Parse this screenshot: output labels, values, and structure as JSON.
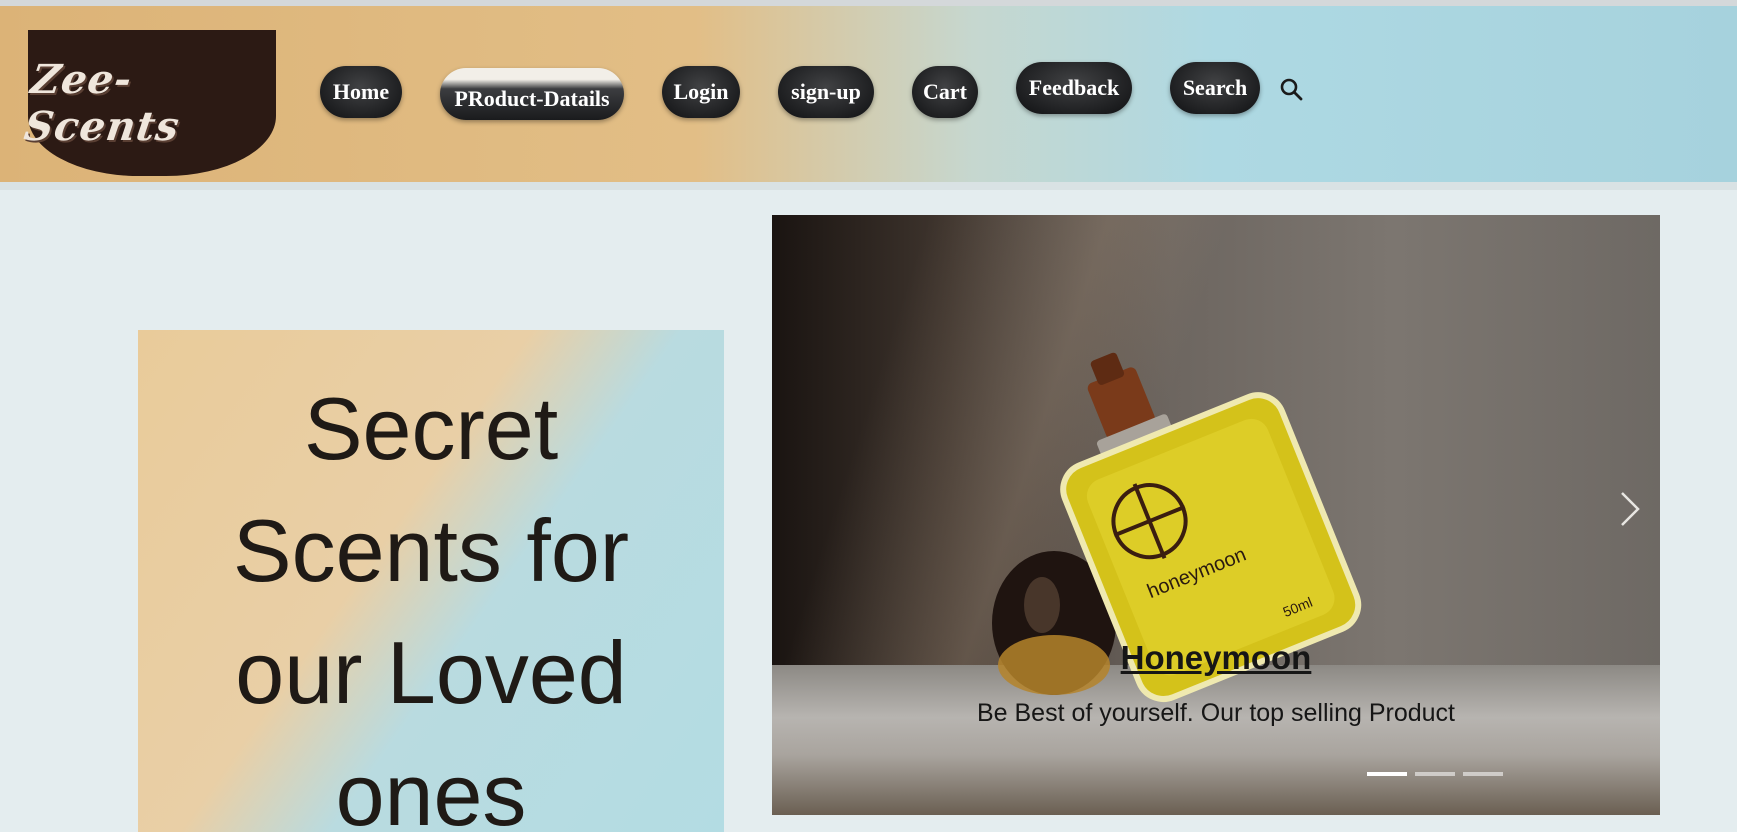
{
  "brand": {
    "logo_text": "Zee-Scents"
  },
  "nav": {
    "items": [
      {
        "label": "Home",
        "active": false
      },
      {
        "label": "PRoduct-Datails",
        "active": true
      },
      {
        "label": "Login",
        "active": false
      },
      {
        "label": "sign-up",
        "active": false
      },
      {
        "label": "Cart",
        "active": false
      },
      {
        "label": "Feedback",
        "active": false
      },
      {
        "label": "Search",
        "active": false
      }
    ],
    "search_icon": "search-icon"
  },
  "hero": {
    "lines": [
      "Secret",
      "Scents for",
      "our Loved",
      "ones"
    ]
  },
  "carousel": {
    "slide_title": "Honeymoon",
    "slide_text": "Be Best of yourself. Our top selling Product",
    "bottle_label": "honeymoon",
    "bottle_volume": "50ml",
    "slide_count": 3,
    "active_slide": 1,
    "next_icon": "chevron-right-icon"
  },
  "colors": {
    "nav_button": "#1e1f21",
    "logo_bg": "#2c1a14",
    "perfume_yellow": "#d4c21a"
  }
}
